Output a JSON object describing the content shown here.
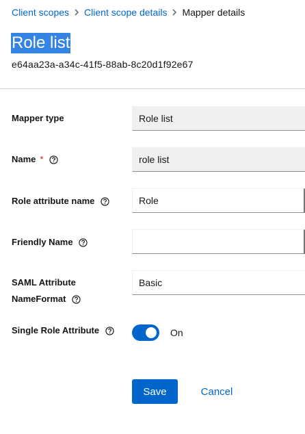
{
  "breadcrumb": {
    "items": [
      {
        "label": "Client scopes"
      },
      {
        "label": "Client scope details"
      },
      {
        "label": "Mapper details"
      }
    ]
  },
  "header": {
    "title": "Role list",
    "subtitle": "e64aa23a-a34c-41f5-88ab-8c20d1f92e67"
  },
  "form": {
    "mapper_type": {
      "label": "Mapper type",
      "value": "Role list"
    },
    "name": {
      "label": "Name",
      "required_mark": "*",
      "value": "role list"
    },
    "role_attribute_name": {
      "label": "Role attribute name",
      "value": "Role"
    },
    "friendly_name": {
      "label": "Friendly Name",
      "value": ""
    },
    "saml_attribute_nameformat": {
      "label_line1": "SAML Attribute",
      "label_line2": "NameFormat",
      "value": "Basic"
    },
    "single_role_attribute": {
      "label": "Single Role Attribute",
      "enabled": true,
      "state_label": "On"
    }
  },
  "actions": {
    "save_label": "Save",
    "cancel_label": "Cancel"
  },
  "colors": {
    "primary": "#0066cc",
    "title_highlight": "#3584e4",
    "required": "#c9190b"
  },
  "icons": {
    "help": "help-icon",
    "breadcrumb_separator": "chevron-right-icon"
  }
}
